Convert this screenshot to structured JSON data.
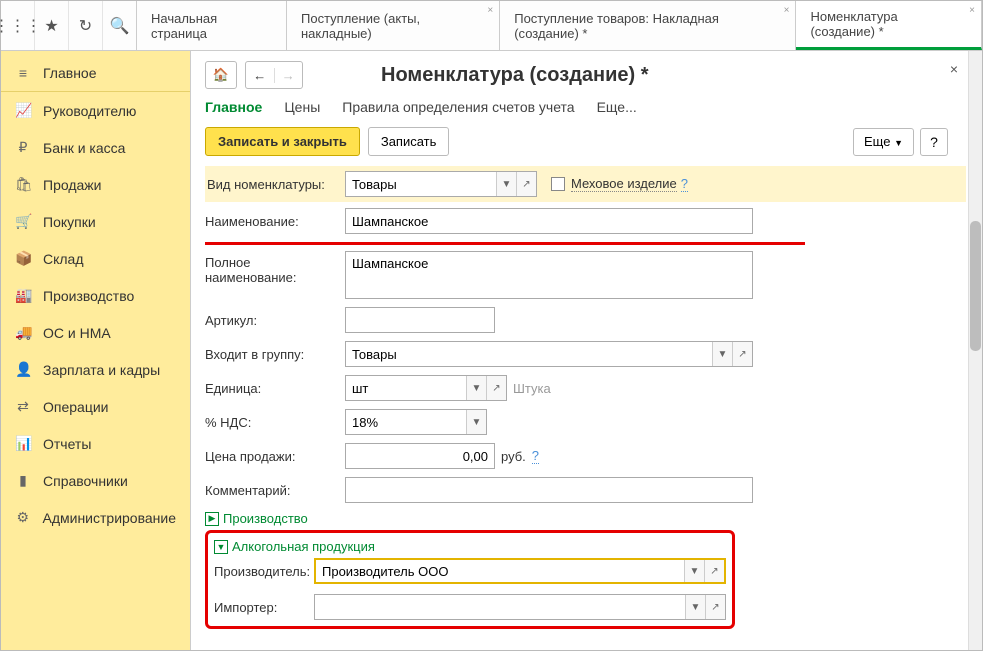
{
  "tabs": {
    "t1": "Начальная страница",
    "t2": "Поступление (акты, накладные)",
    "t3": "Поступление товаров: Накладная (создание) *",
    "t4": "Номенклатура (создание) *"
  },
  "sidebar": {
    "items": [
      {
        "label": "Главное"
      },
      {
        "label": "Руководителю"
      },
      {
        "label": "Банк и касса"
      },
      {
        "label": "Продажи"
      },
      {
        "label": "Покупки"
      },
      {
        "label": "Склад"
      },
      {
        "label": "Производство"
      },
      {
        "label": "ОС и НМА"
      },
      {
        "label": "Зарплата и кадры"
      },
      {
        "label": "Операции"
      },
      {
        "label": "Отчеты"
      },
      {
        "label": "Справочники"
      },
      {
        "label": "Администрирование"
      }
    ]
  },
  "page": {
    "title": "Номенклатура (создание) *",
    "subtabs": {
      "main": "Главное",
      "prices": "Цены",
      "rules": "Правила определения счетов учета",
      "more": "Еще..."
    },
    "buttons": {
      "save_close": "Записать и закрыть",
      "save": "Записать",
      "more": "Еще",
      "help": "?"
    }
  },
  "form": {
    "kind_label": "Вид номенклатуры:",
    "kind_value": "Товары",
    "fur_label": "Меховое изделие",
    "fur_q": "?",
    "name_label": "Наименование:",
    "name_value": "Шампанское",
    "fullname_label": "Полное наименование:",
    "fullname_value": "Шампанское",
    "article_label": "Артикул:",
    "group_label": "Входит в группу:",
    "group_value": "Товары",
    "unit_label": "Единица:",
    "unit_value": "шт",
    "unit_hint": "Штука",
    "vat_label": "% НДС:",
    "vat_value": "18%",
    "price_label": "Цена продажи:",
    "price_value": "0,00",
    "price_cur": "руб.",
    "price_q": "?",
    "comment_label": "Комментарий:",
    "production": "Производство",
    "alco_section": "Алкогольная продукция",
    "manufacturer_label": "Производитель:",
    "manufacturer_value": "Производитель ООО",
    "importer_label": "Импортер:"
  }
}
